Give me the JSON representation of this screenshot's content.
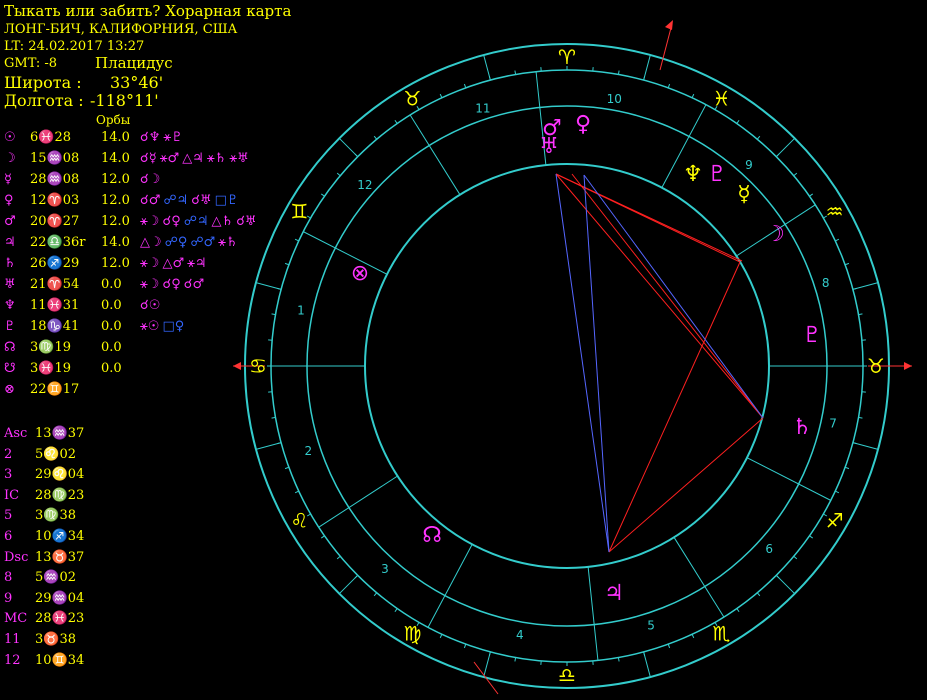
{
  "header": {
    "title": "Тыкать или забить? Хорарная карта",
    "place": "ЛОНГ-БИЧ, КАЛИФОРНИЯ, США",
    "lt": "LT: 24.02.2017  13:27",
    "gmt": "GMT: -8",
    "system": "Плацидус",
    "lat_label": "Широта :",
    "lat_value": "33°46'",
    "lon_label": "Долгота :",
    "lon_value": "-118°11'",
    "orbs_label": "Орбы"
  },
  "planets": [
    {
      "glyph": "☉",
      "pos": "6♓28",
      "orb": "14.0",
      "aspects": [
        {
          "t": "☌♆",
          "c": "#ff33ff"
        },
        {
          "t": "⚹♇",
          "c": "#ff33ff"
        }
      ]
    },
    {
      "glyph": "☽",
      "pos": "15♒08",
      "orb": "14.0",
      "aspects": [
        {
          "t": "☌☿",
          "c": "#ff33ff"
        },
        {
          "t": "⚹♂",
          "c": "#ff33ff"
        },
        {
          "t": "△♃",
          "c": "#ff33ff"
        },
        {
          "t": "⚹♄",
          "c": "#ff33ff"
        },
        {
          "t": "⚹♅",
          "c": "#ff33ff"
        }
      ]
    },
    {
      "glyph": "☿",
      "pos": "28♒08",
      "orb": "12.0",
      "aspects": [
        {
          "t": "☌☽",
          "c": "#ff33ff"
        }
      ]
    },
    {
      "glyph": "♀",
      "pos": "12♈03",
      "orb": "12.0",
      "aspects": [
        {
          "t": "☌♂",
          "c": "#ff33ff"
        },
        {
          "t": "☍♃",
          "c": "#3366ff"
        },
        {
          "t": "☌♅",
          "c": "#ff33ff"
        },
        {
          "t": "□♇",
          "c": "#3366ff"
        }
      ]
    },
    {
      "glyph": "♂",
      "pos": "20♈27",
      "orb": "12.0",
      "aspects": [
        {
          "t": "⚹☽",
          "c": "#ff33ff"
        },
        {
          "t": "☌♀",
          "c": "#ff33ff"
        },
        {
          "t": "☍♃",
          "c": "#3366ff"
        },
        {
          "t": "△♄",
          "c": "#ff33ff"
        },
        {
          "t": "☌♅",
          "c": "#ff33ff"
        }
      ]
    },
    {
      "glyph": "♃",
      "pos": "22♎36r",
      "orb": "14.0",
      "aspects": [
        {
          "t": "△☽",
          "c": "#ff33ff"
        },
        {
          "t": "☍♀",
          "c": "#3366ff"
        },
        {
          "t": "☍♂",
          "c": "#3366ff"
        },
        {
          "t": "⚹♄",
          "c": "#ff33ff"
        }
      ]
    },
    {
      "glyph": "♄",
      "pos": "26♐29",
      "orb": "12.0",
      "aspects": [
        {
          "t": "⚹☽",
          "c": "#ff33ff"
        },
        {
          "t": "△♂",
          "c": "#ff33ff"
        },
        {
          "t": "⚹♃",
          "c": "#ff33ff"
        }
      ]
    },
    {
      "glyph": "♅",
      "pos": "21♈54",
      "orb": "0.0",
      "aspects": [
        {
          "t": "⚹☽",
          "c": "#ff33ff"
        },
        {
          "t": "☌♀",
          "c": "#ff33ff"
        },
        {
          "t": "☌♂",
          "c": "#ff33ff"
        }
      ]
    },
    {
      "glyph": "♆",
      "pos": "11♓31",
      "orb": "0.0",
      "aspects": [
        {
          "t": "☌☉",
          "c": "#ff33ff"
        }
      ]
    },
    {
      "glyph": "♇",
      "pos": "18♑41",
      "orb": "0.0",
      "aspects": [
        {
          "t": "⚹☉",
          "c": "#ff33ff"
        },
        {
          "t": "□♀",
          "c": "#3366ff"
        }
      ]
    },
    {
      "glyph": "☊",
      "pos": "3♍19",
      "orb": "0.0",
      "aspects": []
    },
    {
      "glyph": "☋",
      "pos": "3♓19",
      "orb": "0.0",
      "aspects": []
    },
    {
      "glyph": "⊗",
      "pos": "22♊17",
      "orb": "",
      "aspects": []
    }
  ],
  "houses": [
    {
      "label": "Asc",
      "val": "13♒37"
    },
    {
      "label": "2",
      "val": "5♌02"
    },
    {
      "label": "3",
      "val": "29♌04"
    },
    {
      "label": "IC",
      "val": "28♍23"
    },
    {
      "label": "5",
      "val": "3♍38"
    },
    {
      "label": "6",
      "val": "10♐34"
    },
    {
      "label": "Dsc",
      "val": "13♉37"
    },
    {
      "label": "8",
      "val": "5♒02"
    },
    {
      "label": "9",
      "val": "29♒04"
    },
    {
      "label": "MC",
      "val": "28♓23"
    },
    {
      "label": "11",
      "val": "3♉38"
    },
    {
      "label": "12",
      "val": "10♊34"
    }
  ],
  "wheel_signs": [
    {
      "glyph": "♈",
      "color": "#ffff00"
    },
    {
      "glyph": "♓",
      "color": "#ffff00"
    },
    {
      "glyph": "♒",
      "color": "#ffff00"
    },
    {
      "glyph": "♉",
      "color": "#ffff00"
    },
    {
      "glyph": "♐",
      "color": "#ffff00"
    },
    {
      "glyph": "♏",
      "color": "#ffff00"
    },
    {
      "glyph": "♎",
      "color": "#ffff00"
    },
    {
      "glyph": "♍",
      "color": "#ffff00"
    },
    {
      "glyph": "♌",
      "color": "#ffff00"
    },
    {
      "glyph": "♋",
      "color": "#ffff00"
    },
    {
      "glyph": "♊",
      "color": "#ffff00"
    },
    {
      "glyph": "♉",
      "color": "#ffff00"
    }
  ],
  "wheel_houses": [
    "10",
    "9",
    "8",
    "7",
    "6",
    "5",
    "4",
    "3",
    "2",
    "1",
    "12",
    "11"
  ],
  "wheel_planets": [
    {
      "glyph": "♂",
      "color": "#ff33ff"
    },
    {
      "glyph": "♀",
      "color": "#ff33ff"
    },
    {
      "glyph": "♅",
      "color": "#ff33ff"
    },
    {
      "glyph": "♆",
      "color": "#ffff00"
    },
    {
      "glyph": "♇",
      "color": "#ff33ff"
    },
    {
      "glyph": "☿",
      "color": "#ffff00"
    },
    {
      "glyph": "☽",
      "color": "#ff33ff"
    },
    {
      "glyph": "♇",
      "color": "#ff33ff"
    },
    {
      "glyph": "♄",
      "color": "#ff33ff"
    },
    {
      "glyph": "♃",
      "color": "#ff33ff"
    },
    {
      "glyph": "☊",
      "color": "#ff33ff"
    },
    {
      "glyph": "⊗",
      "color": "#ff33ff"
    }
  ],
  "colors": {
    "ring": "#33cccc",
    "line_red": "#ff2020",
    "line_blue": "#5566ff",
    "axis_red": "#ff3333",
    "text_yellow": "#ffff00",
    "text_magenta": "#ff33ff"
  }
}
